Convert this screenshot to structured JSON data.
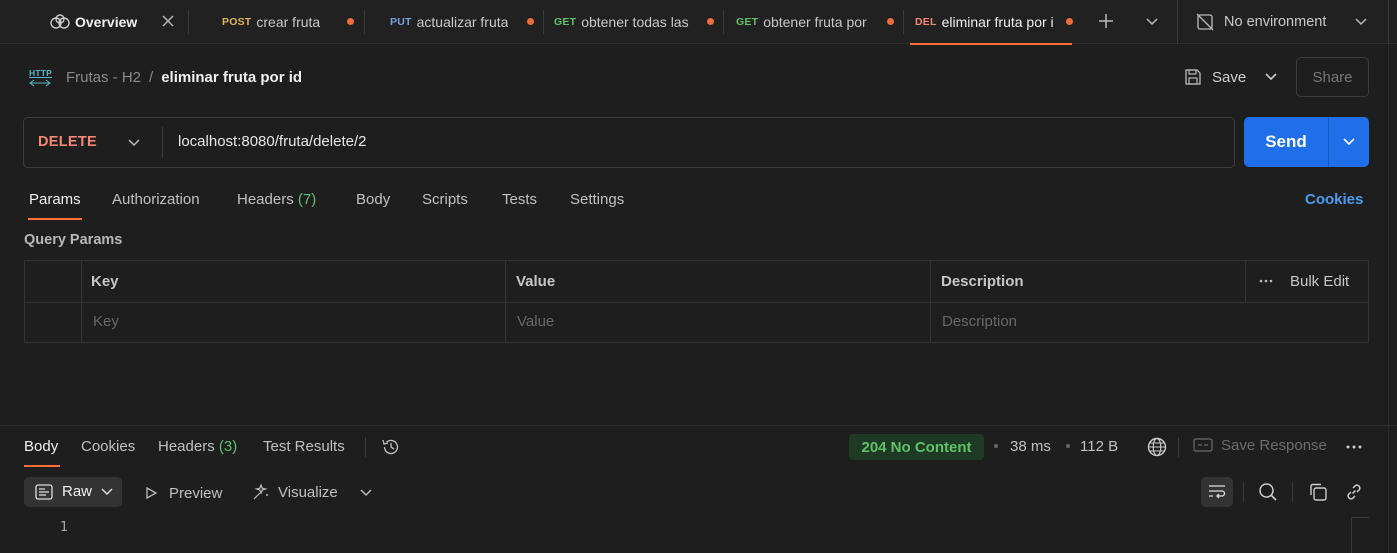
{
  "tabs": [
    {
      "method": "",
      "label": "Overview"
    },
    {
      "method": "POST",
      "label": "crear fruta",
      "method_color": "#e0b454"
    },
    {
      "method": "PUT",
      "label": "actualizar fruta",
      "method_color": "#7aa2dd"
    },
    {
      "method": "GET",
      "label": "obtener todas las",
      "method_color": "#5ec26a"
    },
    {
      "method": "GET",
      "label": "obtener fruta por",
      "method_color": "#5ec26a"
    },
    {
      "method": "DEL",
      "label": "eliminar fruta por i",
      "method_color": "#f48771"
    }
  ],
  "environment": {
    "label": "No environment"
  },
  "breadcrumb": {
    "collection": "Frutas - H2",
    "separator": "/",
    "request": "eliminar fruta por id",
    "icon_text": "HTTP"
  },
  "actions": {
    "save_label": "Save",
    "share_label": "Share"
  },
  "request": {
    "method": "DELETE",
    "url": "localhost:8080/fruta/delete/2",
    "send_label": "Send"
  },
  "request_tabs": [
    {
      "label": "Params"
    },
    {
      "label": "Authorization"
    },
    {
      "label": "Headers",
      "count": "(7)"
    },
    {
      "label": "Body"
    },
    {
      "label": "Scripts"
    },
    {
      "label": "Tests"
    },
    {
      "label": "Settings"
    }
  ],
  "cookies_link": "Cookies",
  "query_params": {
    "title": "Query Params",
    "columns": [
      "Key",
      "Value",
      "Description"
    ],
    "bulk_edit": "Bulk Edit",
    "placeholders": [
      "Key",
      "Value",
      "Description"
    ]
  },
  "response": {
    "tabs": [
      {
        "label": "Body"
      },
      {
        "label": "Cookies"
      },
      {
        "label": "Headers",
        "count": "(3)"
      },
      {
        "label": "Test Results"
      }
    ],
    "status": "204 No Content",
    "time": "38 ms",
    "size": "112 B",
    "save_label": "Save Response",
    "format": "Raw",
    "preview_label": "Preview",
    "visualize_label": "Visualize",
    "line_numbers": [
      "1"
    ]
  },
  "colors": {
    "accent": "#ff6c37",
    "send": "#1f6feb",
    "delete_method": "#f48771",
    "status_ok": "#5ec26a",
    "link": "#4a9cf0"
  }
}
